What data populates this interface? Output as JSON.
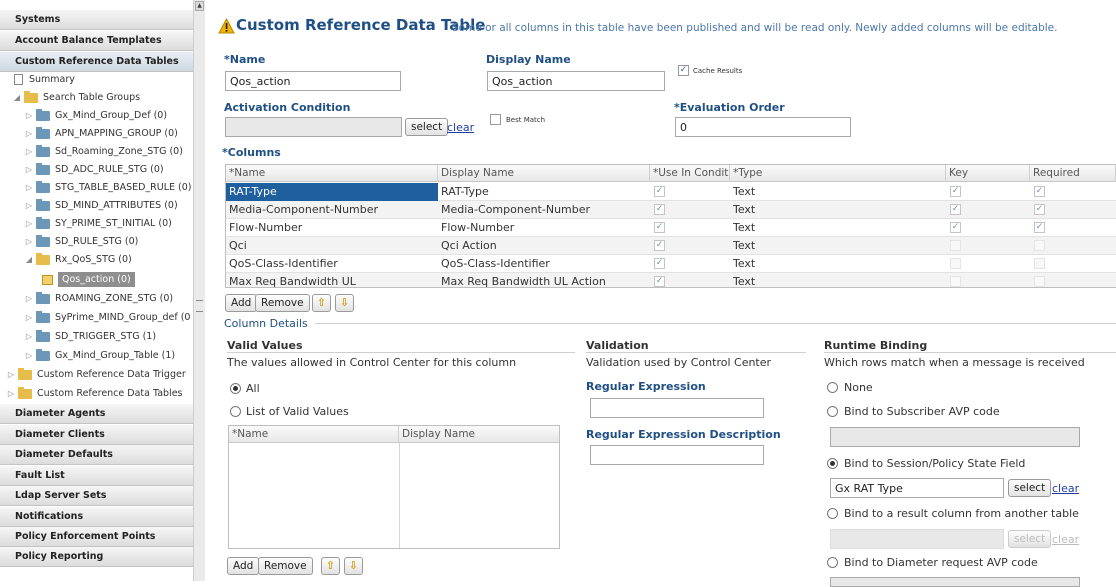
{
  "sidebar": {
    "top_items": [
      "Systems",
      "Account Balance Templates",
      "Custom Reference Data Tables"
    ],
    "summary": "Summary",
    "search_table_groups": "Search Table Groups",
    "groups": [
      "Gx_Mind_Group_Def (0)",
      "APN_MAPPING_GROUP (0)",
      "Sd_Roaming_Zone_STG (0)",
      "SD_ADC_RULE_STG (0)",
      "STG_TABLE_BASED_RULE (0)",
      "SD_MIND_ATTRIBUTES (0)",
      "SY_PRIME_ST_INITIAL (0)",
      "SD_RULE_STG (0)",
      "Rx_QoS_STG (0)"
    ],
    "selected_table": "Qos_action (0)",
    "groups_after": [
      "ROAMING_ZONE_STG (0)",
      "SyPrime_MIND_Group_def (0",
      "SD_TRIGGER_STG (1)",
      "Gx_Mind_Group_Table (1)"
    ],
    "folders": [
      "Custom Reference Data Trigger",
      "Custom Reference Data Tables"
    ],
    "bottom_items": [
      "Diameter Agents",
      "Diameter Clients",
      "Diameter Defaults",
      "Fault List",
      "Ldap Server Sets",
      "Notifications",
      "Policy Enforcement Points",
      "Policy Reporting"
    ]
  },
  "header": {
    "title": "Custom Reference Data Table",
    "message": "Some or all columns in this table have been published and will be read only. Newly added columns will be editable."
  },
  "form": {
    "name_label": "*Name",
    "name_value": "Qos_action",
    "display_name_label": "Display Name",
    "display_name_value": "Qos_action",
    "cache_results_label": "Cache Results",
    "activation_label": "Activation Condition",
    "activation_value": "",
    "select_label": "select",
    "clear_label": "clear",
    "best_match_label": "Best Match",
    "eval_order_label": "*Evaluation Order",
    "eval_order_value": "0",
    "columns_label": "*Columns"
  },
  "columns_table": {
    "headers": [
      "*Name",
      "Display Name",
      "*Use In Conditi",
      "*Type",
      "Key",
      "Required"
    ],
    "rows": [
      {
        "name": "RAT-Type",
        "display": "RAT-Type",
        "use": true,
        "type": "Text",
        "key": true,
        "required": true
      },
      {
        "name": "Media-Component-Number",
        "display": "Media-Component-Number",
        "use": true,
        "type": "Text",
        "key": true,
        "required": true
      },
      {
        "name": "Flow-Number",
        "display": "Flow-Number",
        "use": true,
        "type": "Text",
        "key": true,
        "required": true
      },
      {
        "name": "Qci",
        "display": "Qci Action",
        "use": true,
        "type": "Text",
        "key": false,
        "required": false
      },
      {
        "name": "QoS-Class-Identifier",
        "display": "QoS-Class-Identifier",
        "use": true,
        "type": "Text",
        "key": false,
        "required": false
      },
      {
        "name": "Max Req Bandwidth UL",
        "display": "Max Req Bandwidth UL Action",
        "use": true,
        "type": "Text",
        "key": false,
        "required": false
      }
    ],
    "add": "Add",
    "remove": "Remove"
  },
  "column_details": {
    "title": "Column Details",
    "valid_values": {
      "title": "Valid Values",
      "desc": "The values allowed in Control Center for this column",
      "all": "All",
      "list": "List of Valid Values",
      "headers": [
        "*Name",
        "Display Name"
      ],
      "add": "Add",
      "remove": "Remove"
    },
    "validation": {
      "title": "Validation",
      "desc": "Validation used by Control Center",
      "regex_label": "Regular Expression",
      "regex_desc_label": "Regular Expression Description"
    },
    "runtime": {
      "title": "Runtime Binding",
      "desc": "Which rows match when a message is received",
      "none": "None",
      "subscriber_avp": "Bind to Subscriber AVP code",
      "session_state": "Bind to Session/Policy State Field",
      "session_value": "Gx RAT Type",
      "result_column": "Bind to a result column from another table",
      "diameter_avp": "Bind to Diameter request AVP code"
    }
  },
  "colors": {
    "label_blue": "#1f4f84",
    "selected_row": "#1f5f9e",
    "warning": "#e0a800"
  }
}
